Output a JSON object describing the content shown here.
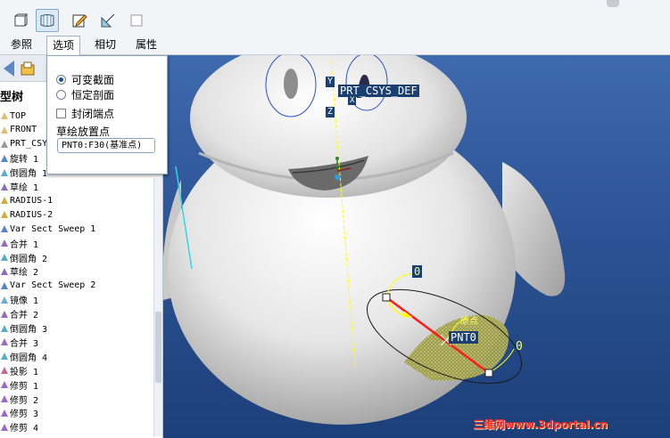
{
  "toolbar": {
    "icons": [
      "cube-icon",
      "surface-icon",
      "sketch-edit-icon",
      "section-icon",
      "blank-icon"
    ],
    "tabs": [
      {
        "label": "参照",
        "active": false
      },
      {
        "label": "选项",
        "active": true
      },
      {
        "label": "相切",
        "active": false
      },
      {
        "label": "属性",
        "active": false
      }
    ]
  },
  "options": {
    "radio_variable": "可变截面",
    "radio_constant": "恒定剖面",
    "selected": "可变截面",
    "closed_ends": "封闭端点",
    "closed_ends_checked": false,
    "sketch_point_label": "草绘放置点",
    "sketch_point_value": "PNT0:F30(基准点)"
  },
  "tree": {
    "title": "型树",
    "items": [
      {
        "label": "TOP",
        "icon": "datum-plane-icon"
      },
      {
        "label": "FRONT",
        "icon": "datum-plane-icon"
      },
      {
        "label": "PRT_CSYS",
        "icon": "csys-icon"
      },
      {
        "label": "旋转 1",
        "icon": "revolve-icon"
      },
      {
        "label": "倒圆角 1",
        "icon": "round-icon"
      },
      {
        "label": "草绘 1",
        "icon": "sketch-icon"
      },
      {
        "label": "RADIUS-1",
        "icon": "graph-icon"
      },
      {
        "label": "RADIUS-2",
        "icon": "graph-icon"
      },
      {
        "label": "Var Sect Sweep 1",
        "icon": "sweep-icon"
      },
      {
        "label": "合并 1",
        "icon": "merge-icon"
      },
      {
        "label": "倒圆角 2",
        "icon": "round-icon"
      },
      {
        "label": "草绘 2",
        "icon": "sketch-icon"
      },
      {
        "label": "Var Sect Sweep 2",
        "icon": "sweep-icon"
      },
      {
        "label": "镜像 1",
        "icon": "mirror-icon"
      },
      {
        "label": "合并 2",
        "icon": "merge-icon"
      },
      {
        "label": "倒圆角 3",
        "icon": "round-icon"
      },
      {
        "label": "合并 3",
        "icon": "merge-icon"
      },
      {
        "label": "倒圆角 4",
        "icon": "round-icon"
      },
      {
        "label": "投影 1",
        "icon": "project-icon"
      },
      {
        "label": "修剪 1",
        "icon": "trim-icon"
      },
      {
        "label": "修剪 2",
        "icon": "trim-icon"
      },
      {
        "label": "修剪 3",
        "icon": "trim-icon"
      },
      {
        "label": "修剪 4",
        "icon": "trim-icon"
      }
    ]
  },
  "viewport": {
    "csys_label": "PRT_CSYS_DEF",
    "axis_y": "Y",
    "axis_z": "Z",
    "axis_x": "X",
    "pnt_label": "PNT0",
    "origin_label": "原点",
    "dim_top": "0",
    "dim_right": "0"
  },
  "watermark": "三维网www.3dportal.cn",
  "colors": {
    "background_top": "#3f6aad",
    "background_bottom": "#1d3f79",
    "trajectory": "#ff1a1a",
    "label_yellow": "#ffff66"
  }
}
